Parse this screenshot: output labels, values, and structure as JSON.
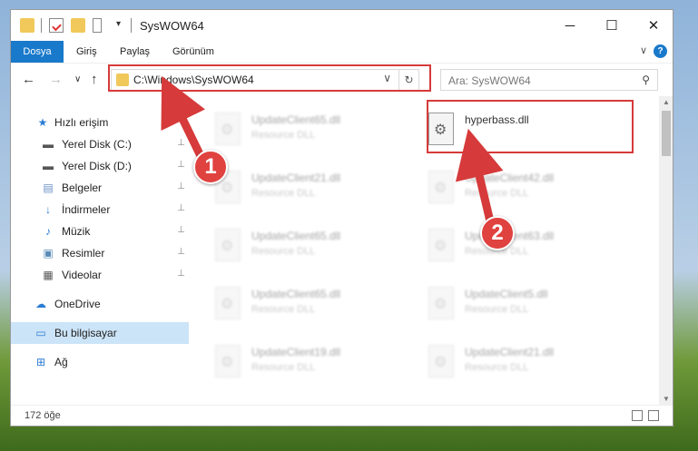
{
  "window": {
    "title": "SysWOW64",
    "controls": {
      "minimize": "─",
      "maximize": "☐",
      "close": "✕"
    }
  },
  "ribbon": {
    "tabs": [
      "Dosya",
      "Giriş",
      "Paylaş",
      "Görünüm"
    ],
    "expand": "∨",
    "help": "?"
  },
  "navbar": {
    "back": "←",
    "forward": "→",
    "recent": "∨",
    "up": "↑",
    "address": "C:\\Windows\\SysWOW64",
    "address_dropdown": "∨",
    "refresh": "↻",
    "search_placeholder": "Ara: SysWOW64",
    "search_icon": "⚲"
  },
  "sidebar": {
    "items": [
      {
        "label": "Hızlı erişim",
        "icon": "star-icon",
        "glyph": "★",
        "color": "#2b7cd3",
        "pinned": false
      },
      {
        "label": "Yerel Disk (C:)",
        "icon": "drive-icon",
        "glyph": "▬",
        "color": "#555555",
        "pinned": true
      },
      {
        "label": "Yerel Disk (D:)",
        "icon": "drive-icon",
        "glyph": "▬",
        "color": "#555555",
        "pinned": true
      },
      {
        "label": "Belgeler",
        "icon": "documents-icon",
        "glyph": "▤",
        "color": "#6b8fc6",
        "pinned": true
      },
      {
        "label": "İndirmeler",
        "icon": "download-icon",
        "glyph": "↓",
        "color": "#2b7cd3",
        "pinned": true
      },
      {
        "label": "Müzik",
        "icon": "music-icon",
        "glyph": "♪",
        "color": "#2b7cd3",
        "pinned": true
      },
      {
        "label": "Resimler",
        "icon": "pictures-icon",
        "glyph": "▣",
        "color": "#5a8bb8",
        "pinned": true
      },
      {
        "label": "Videolar",
        "icon": "videos-icon",
        "glyph": "▦",
        "color": "#555555",
        "pinned": true
      },
      {
        "label": "OneDrive",
        "icon": "cloud-icon",
        "glyph": "☁",
        "color": "#2b7cd3",
        "pinned": false
      },
      {
        "label": "Bu bilgisayar",
        "icon": "computer-icon",
        "glyph": "▭",
        "color": "#2b7cd3",
        "pinned": false,
        "selected": true
      },
      {
        "label": "Ağ",
        "icon": "network-icon",
        "glyph": "⊞",
        "color": "#2b7cd3",
        "pinned": false
      }
    ],
    "pin_glyph": "📌"
  },
  "files": [
    {
      "name": "UpdateClient65.dll",
      "type": "Resource DLL",
      "blurred": true
    },
    {
      "name": "hyperbass.dll",
      "type": "",
      "blurred": false
    },
    {
      "name": "UpdateClient21.dll",
      "type": "Resource DLL",
      "blurred": true
    },
    {
      "name": "UpdateClient42.dll",
      "type": "Resource DLL",
      "blurred": true
    },
    {
      "name": "UpdateClient65.dll",
      "type": "Resource DLL",
      "blurred": true
    },
    {
      "name": "UpdateClient63.dll",
      "type": "Resource DLL",
      "blurred": true
    },
    {
      "name": "UpdateClient65.dll",
      "type": "Resource DLL",
      "blurred": true
    },
    {
      "name": "UpdateClient5.dll",
      "type": "Resource DLL",
      "blurred": true
    },
    {
      "name": "UpdateClient19.dll",
      "type": "Resource DLL",
      "blurred": true
    },
    {
      "name": "UpdateClient21.dll",
      "type": "Resource DLL",
      "blurred": true
    }
  ],
  "status": {
    "item_count": "172 öğe"
  },
  "annotations": {
    "badge1": "1",
    "badge2": "2",
    "color": "#d63a3a"
  }
}
